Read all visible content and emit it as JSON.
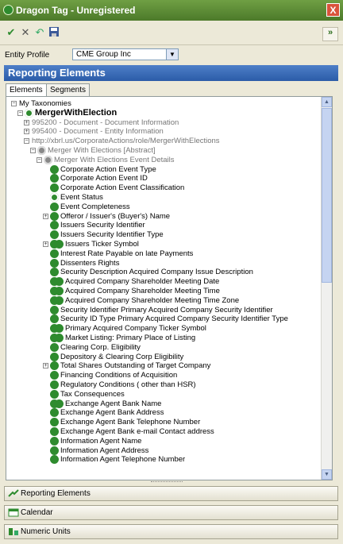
{
  "window": {
    "title": "Dragon Tag - Unregistered",
    "close_label": "X"
  },
  "toolbar": {
    "expand_label": "»"
  },
  "entity_profile": {
    "label": "Entity Profile",
    "value": "CME Group Inc"
  },
  "panel": {
    "title": "Reporting Elements",
    "tabs": [
      "Elements",
      "Segments"
    ]
  },
  "tree": [
    {
      "text": "My Taxonomies",
      "indent": 0,
      "exp": "−",
      "icon": null,
      "style": ""
    },
    {
      "text": "MergerWithElection",
      "indent": 1,
      "exp": "−",
      "icon": "green-ring",
      "style": "bold"
    },
    {
      "text": "995200 - Document - Document Information",
      "indent": 2,
      "exp": "+",
      "icon": null,
      "style": "grey"
    },
    {
      "text": "995400 - Document - Entity Information",
      "indent": 2,
      "exp": "+",
      "icon": null,
      "style": "grey"
    },
    {
      "text": "http://xbrl.us/CorporateActions/role/MergerWithElections",
      "indent": 2,
      "exp": "−",
      "icon": null,
      "style": "grey"
    },
    {
      "text": "Merger With Elections [Abstract]",
      "indent": 3,
      "exp": "−",
      "icon": "grey-a",
      "style": "grey"
    },
    {
      "text": "Merger With Elections Event Details",
      "indent": 4,
      "exp": "−",
      "icon": "grey-a",
      "style": "grey"
    },
    {
      "text": "Corporate Action Event Type",
      "indent": 5,
      "exp": null,
      "icon": "green",
      "style": ""
    },
    {
      "text": "Corporate Action Event ID",
      "indent": 5,
      "exp": null,
      "icon": "green",
      "style": ""
    },
    {
      "text": "Corporate Action Event Classification",
      "indent": 5,
      "exp": null,
      "icon": "green",
      "style": ""
    },
    {
      "text": "Event Status",
      "indent": 5,
      "exp": null,
      "icon": "green-ring",
      "style": ""
    },
    {
      "text": "Event Completeness",
      "indent": 5,
      "exp": null,
      "icon": "green",
      "style": ""
    },
    {
      "text": "Offeror / Issuer's (Buyer's) Name",
      "indent": 5,
      "exp": "+",
      "icon": "green",
      "style": ""
    },
    {
      "text": "Issuers Security Identifier",
      "indent": 5,
      "exp": null,
      "icon": "green",
      "style": ""
    },
    {
      "text": "Issuers Security Identifier Type",
      "indent": 5,
      "exp": null,
      "icon": "green",
      "style": ""
    },
    {
      "text": "Issuers Ticker Symbol",
      "indent": 5,
      "exp": "+",
      "icon": "green-double",
      "style": ""
    },
    {
      "text": "Interest Rate Payable on late Payments",
      "indent": 5,
      "exp": null,
      "icon": "green",
      "style": ""
    },
    {
      "text": "Dissenters Rights",
      "indent": 5,
      "exp": null,
      "icon": "green",
      "style": ""
    },
    {
      "text": "Security Description Acquired Company Issue Description",
      "indent": 5,
      "exp": null,
      "icon": "green",
      "style": ""
    },
    {
      "text": "Acquired Company Shareholder Meeting Date",
      "indent": 5,
      "exp": null,
      "icon": "green-double",
      "style": ""
    },
    {
      "text": "Acquired Company Shareholder Meeting Time",
      "indent": 5,
      "exp": null,
      "icon": "green-double",
      "style": ""
    },
    {
      "text": "Acquired Company Shareholder Meeting Time Zone",
      "indent": 5,
      "exp": null,
      "icon": "green-double",
      "style": ""
    },
    {
      "text": "Security Identifier Primary Acquired Company Security Identifier",
      "indent": 5,
      "exp": null,
      "icon": "green",
      "style": ""
    },
    {
      "text": "Security ID Type Primary Acquired Company Security Identifier Type",
      "indent": 5,
      "exp": null,
      "icon": "green",
      "style": ""
    },
    {
      "text": "Primary Acquired Company Ticker Symbol",
      "indent": 5,
      "exp": null,
      "icon": "green-double",
      "style": ""
    },
    {
      "text": "Market Listing: Primary Place of Listing",
      "indent": 5,
      "exp": null,
      "icon": "green-double",
      "style": ""
    },
    {
      "text": "Clearing Corp. Eligibility",
      "indent": 5,
      "exp": null,
      "icon": "green",
      "style": ""
    },
    {
      "text": "Depository & Clearing Corp Eligibility",
      "indent": 5,
      "exp": null,
      "icon": "green",
      "style": ""
    },
    {
      "text": "Total Shares Outstanding of Target Company",
      "indent": 5,
      "exp": "+",
      "icon": "green",
      "style": ""
    },
    {
      "text": "Financing Conditions of Acquisition",
      "indent": 5,
      "exp": null,
      "icon": "green",
      "style": ""
    },
    {
      "text": "Regulatory Conditions ( other than HSR)",
      "indent": 5,
      "exp": null,
      "icon": "green",
      "style": ""
    },
    {
      "text": "Tax Consequences",
      "indent": 5,
      "exp": null,
      "icon": "green",
      "style": ""
    },
    {
      "text": "Exchange Agent Bank Name",
      "indent": 5,
      "exp": null,
      "icon": "green-double",
      "style": ""
    },
    {
      "text": "Exchange Agent Bank Address",
      "indent": 5,
      "exp": null,
      "icon": "green",
      "style": ""
    },
    {
      "text": "Exchange Agent Bank Telephone Number",
      "indent": 5,
      "exp": null,
      "icon": "green",
      "style": ""
    },
    {
      "text": "Exchange Agent Bank e-mail Contact address",
      "indent": 5,
      "exp": null,
      "icon": "green",
      "style": ""
    },
    {
      "text": "Information Agent Name",
      "indent": 5,
      "exp": null,
      "icon": "green",
      "style": ""
    },
    {
      "text": "Information Agent Address",
      "indent": 5,
      "exp": null,
      "icon": "green",
      "style": ""
    },
    {
      "text": "Information Agent Telephone Number",
      "indent": 5,
      "exp": null,
      "icon": "green",
      "style": ""
    }
  ],
  "bottom_nav": [
    "Reporting Elements",
    "Calendar",
    "Numeric Units"
  ],
  "colors": {
    "title_green": "#4c7a2a",
    "header_blue": "#2b5ca8",
    "element_green": "#2e8b2e"
  }
}
